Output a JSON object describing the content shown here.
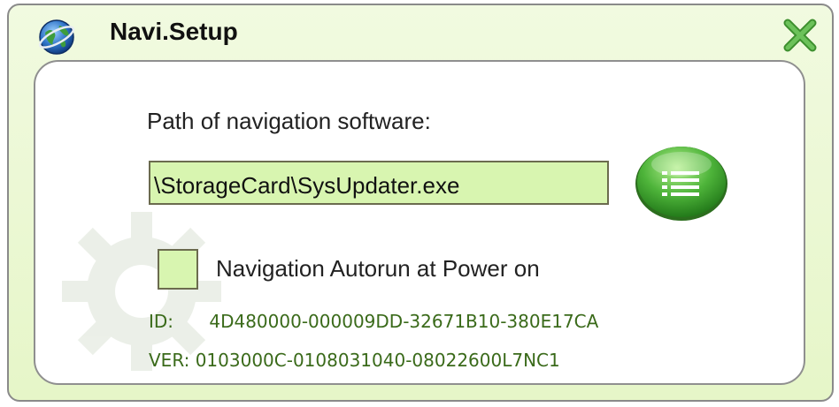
{
  "window": {
    "title": "Navi.Setup",
    "app_icon": "globe-icon",
    "close_icon": "close-x-icon",
    "colors": {
      "frame_background": "#e6f6c8",
      "field_background": "#d8f5b0",
      "close_green": "#4aa83a",
      "button_green": "#48a23a",
      "info_text": "#3a6a1a"
    }
  },
  "form": {
    "path_label": "Path of navigation software:",
    "path_value": "\\StorageCard\\SysUpdater.exe",
    "browse_icon": "list-icon",
    "autorun_label": "Navigation Autorun at Power on",
    "autorun_checked": false
  },
  "info": {
    "id_label": "ID:",
    "id_value": "4D480000-000009DD-32671B10-380E17CA",
    "ver_label": "VER:",
    "ver_value": "0103000C-0108031040-08022600L7NC1"
  }
}
